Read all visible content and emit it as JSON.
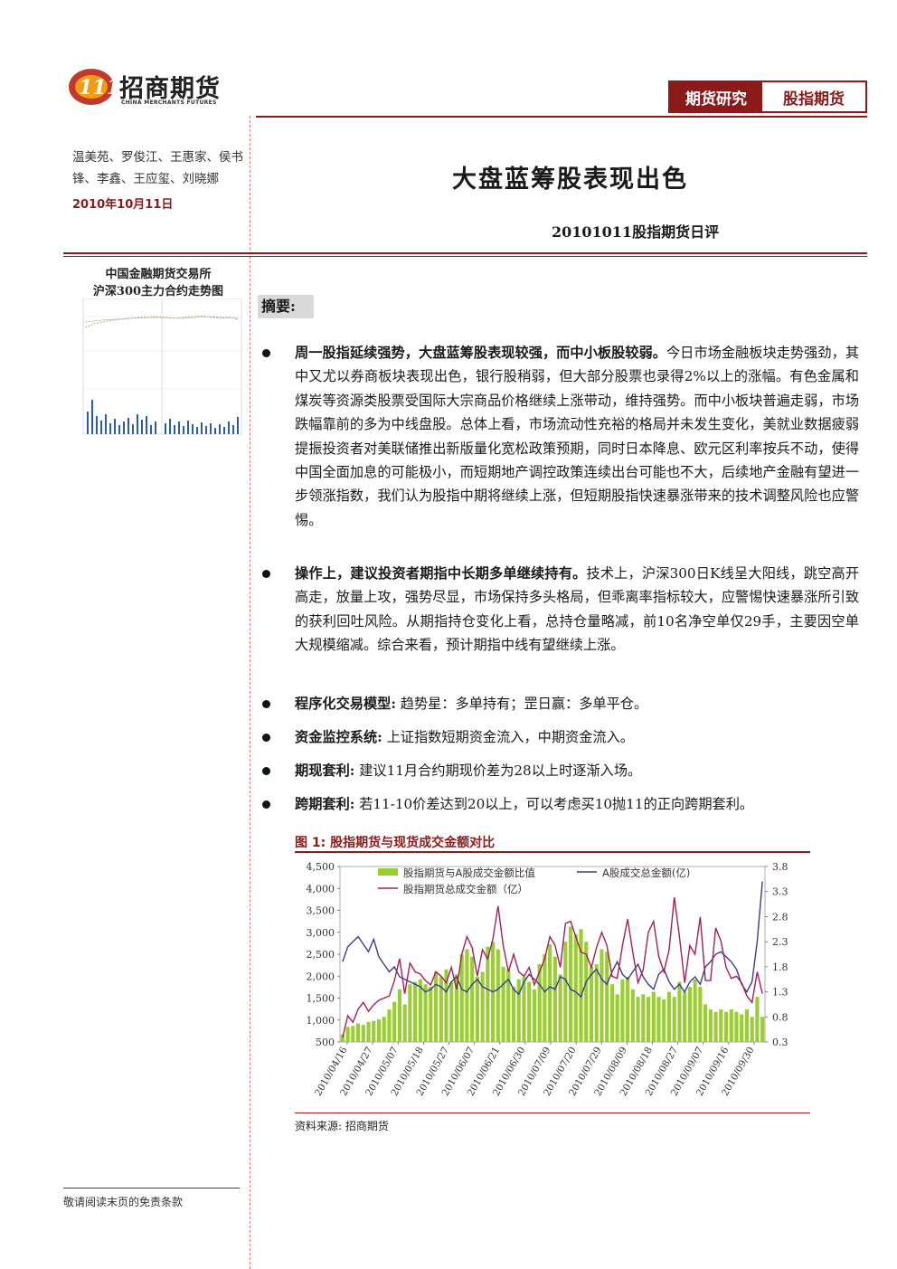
{
  "header": {
    "logo_cn": "招商期货",
    "logo_en": "CHINA MERCHANTS FUTURES",
    "tab_research": "期货研究",
    "tab_category": "股指期货"
  },
  "sidebar": {
    "authors": "温美苑、罗俊江、王惠家、侯书锋、李鑫、王应玺、刘晓娜",
    "date": "2010年10月11日",
    "mini_chart_title_1": "中国金融期货交易所",
    "mini_chart_title_2": "沪深300主力合约走势图"
  },
  "title": "大盘蓝筹股表现出色",
  "subtitle": "20101011股指期货日评",
  "summary": {
    "label": "摘要:",
    "bullets": [
      {
        "lead": "周一股指延续强势，大盘蓝筹股表现较强，而中小板股较弱。",
        "body": "今日市场金融板块走势强劲，其中又尤以券商板块表现出色，银行股稍弱，但大部分股票也录得2%以上的涨幅。有色金属和煤炭等资源类股票受国际大宗商品价格继续上涨带动，维持强势。而中小板块普遍走弱，市场跌幅靠前的多为中线盘股。总体上看，市场流动性充裕的格局并未发生变化，美就业数据疲弱提振投资者对美联储推出新版量化宽松政策预期，同时日本降息、欧元区利率按兵不动，使得中国全面加息的可能极小，而短期地产调控政策连续出台可能也不大，后续地产金融有望进一步领涨指数，我们认为股指中期将继续上涨，但短期股指快速暴涨带来的技术调整风险也应警惕。"
      },
      {
        "lead": "操作上，建议投资者期指中长期多单继续持有。",
        "body": "技术上，沪深300日K线呈大阳线，跳空高开高走，放量上攻，强势尽显，市场保持多头格局，但乖离率指标较大，应警惕快速暴涨所引致的获利回吐风险。从期指持仓变化上看，总持仓量略减，前10名净空单仅29手，主要因空单大规模缩减。综合来看，预计期指中线有望继续上涨。"
      },
      {
        "lead": "程序化交易模型:",
        "body": "趋势星：多单持有；罡日赢：多单平仓。"
      },
      {
        "lead": "资金监控系统:",
        "body": "上证指数短期资金流入，中期资金流入。"
      },
      {
        "lead": "期现套利:",
        "body": "建议11月合约期现价差为28以上时逐渐入场。"
      },
      {
        "lead": "跨期套利:",
        "body": "若11-10价差达到20以上，可以考虑买10抛11的正向跨期套利。"
      }
    ]
  },
  "figure": {
    "title": "图 1: 股指期货与现货成交金额对比",
    "source": "资料来源: 招商期货"
  },
  "footer": "敬请阅读末页的免责条款",
  "colors": {
    "brand": "#8b1a1a",
    "bar": "#9acd32",
    "line_a_share": "#3c3c8c",
    "line_futures": "#a0205a"
  },
  "chart_data": {
    "type": "bar",
    "series": [
      {
        "name": "股指期货与A股成交金额比值",
        "axis": "right",
        "kind": "bar",
        "values": [
          0.45,
          0.6,
          0.62,
          0.67,
          0.64,
          0.7,
          0.72,
          0.75,
          0.8,
          0.95,
          1.1,
          1.35,
          1.05,
          1.45,
          1.5,
          1.55,
          1.45,
          1.4,
          1.7,
          1.6,
          1.75,
          1.5,
          1.65,
          2.05,
          2.15,
          2.0,
          1.6,
          1.7,
          2.2,
          2.3,
          2.15,
          1.8,
          1.75,
          1.4,
          1.55,
          1.6,
          1.5,
          1.35,
          1.85,
          2.05,
          2.25,
          2.0,
          1.65,
          2.3,
          2.6,
          2.45,
          2.55,
          2.3,
          1.8,
          1.85,
          2.15,
          2.1,
          1.45,
          1.25,
          1.55,
          1.6,
          1.35,
          1.2,
          1.25,
          1.2,
          1.3,
          1.2,
          1.15,
          1.3,
          1.2,
          1.5,
          1.3,
          1.4,
          1.55,
          1.4,
          1.05,
          0.95,
          0.9,
          0.95,
          0.9,
          0.95,
          0.9,
          0.85,
          0.95,
          0.8,
          1.2,
          0.8
        ]
      },
      {
        "name": "A股成交总金额(亿)",
        "axis": "right",
        "kind": "line",
        "values": [
          1.9,
          2.2,
          2.3,
          2.4,
          2.25,
          2.1,
          2.35,
          2.0,
          1.85,
          1.7,
          1.8,
          1.6,
          1.55,
          1.5,
          1.45,
          1.4,
          1.3,
          1.35,
          1.45,
          1.4,
          1.3,
          1.5,
          1.6,
          1.35,
          1.3,
          1.45,
          1.55,
          1.4,
          1.35,
          1.3,
          1.35,
          1.45,
          1.55,
          1.35,
          1.25,
          1.5,
          1.65,
          1.55,
          1.45,
          1.3,
          1.4,
          1.35,
          1.6,
          1.55,
          1.35,
          1.3,
          1.2,
          1.5,
          1.65,
          1.75,
          1.55,
          1.45,
          1.7,
          1.9,
          1.65,
          1.55,
          1.7,
          1.85,
          1.6,
          1.45,
          1.35,
          1.65,
          1.75,
          1.5,
          1.35,
          1.45,
          1.3,
          1.5,
          1.6,
          1.45,
          1.8,
          1.9,
          2.05,
          2.1,
          2.0,
          1.9,
          1.75,
          1.45,
          1.3,
          1.5,
          2.3,
          3.5
        ]
      },
      {
        "name": "股指期货总成交金额（亿）",
        "axis": "left",
        "kind": "line",
        "values": [
          600,
          1100,
          950,
          1250,
          1400,
          1200,
          1350,
          1450,
          1500,
          1550,
          1900,
          2400,
          1600,
          2300,
          2100,
          2050,
          1900,
          1800,
          2100,
          2000,
          1850,
          2200,
          1700,
          2500,
          2900,
          2650,
          2000,
          2600,
          2400,
          2850,
          3600,
          2700,
          2100,
          2500,
          2100,
          2000,
          2200,
          1800,
          2100,
          2400,
          2900,
          2700,
          2200,
          3200,
          3250,
          2900,
          2550,
          2500,
          2200,
          2650,
          3000,
          2700,
          2000,
          1950,
          2700,
          3300,
          2550,
          1850,
          2150,
          3000,
          3250,
          2450,
          2100,
          2600,
          3800,
          2900,
          1850,
          2700,
          2500,
          3350,
          1900,
          1900,
          3100,
          2800,
          2200,
          1950,
          2000,
          1850,
          1550,
          1400,
          2100,
          1600
        ]
      }
    ],
    "x_tick_labels": [
      "2010/04/16",
      "2010/04/27",
      "2010/05/07",
      "2010/05/18",
      "2010/05/27",
      "2010/06/07",
      "2010/06/21",
      "2010/06/30",
      "2010/07/09",
      "2010/07/20",
      "2010/07/29",
      "2010/08/09",
      "2010/08/18",
      "2010/08/27",
      "2010/09/07",
      "2010/09/16",
      "2010/09/30"
    ],
    "left_axis": {
      "ylim": [
        500,
        4500
      ],
      "ticks": [
        "500",
        "1,000",
        "1,500",
        "2,000",
        "2,500",
        "3,000",
        "3,500",
        "4,000",
        "4,500"
      ]
    },
    "right_axis": {
      "ylim": [
        0.3,
        3.8
      ],
      "ticks": [
        "0.3",
        "0.8",
        "1.3",
        "1.8",
        "2.3",
        "2.8",
        "3.3",
        "3.8"
      ]
    },
    "legend": "top"
  }
}
